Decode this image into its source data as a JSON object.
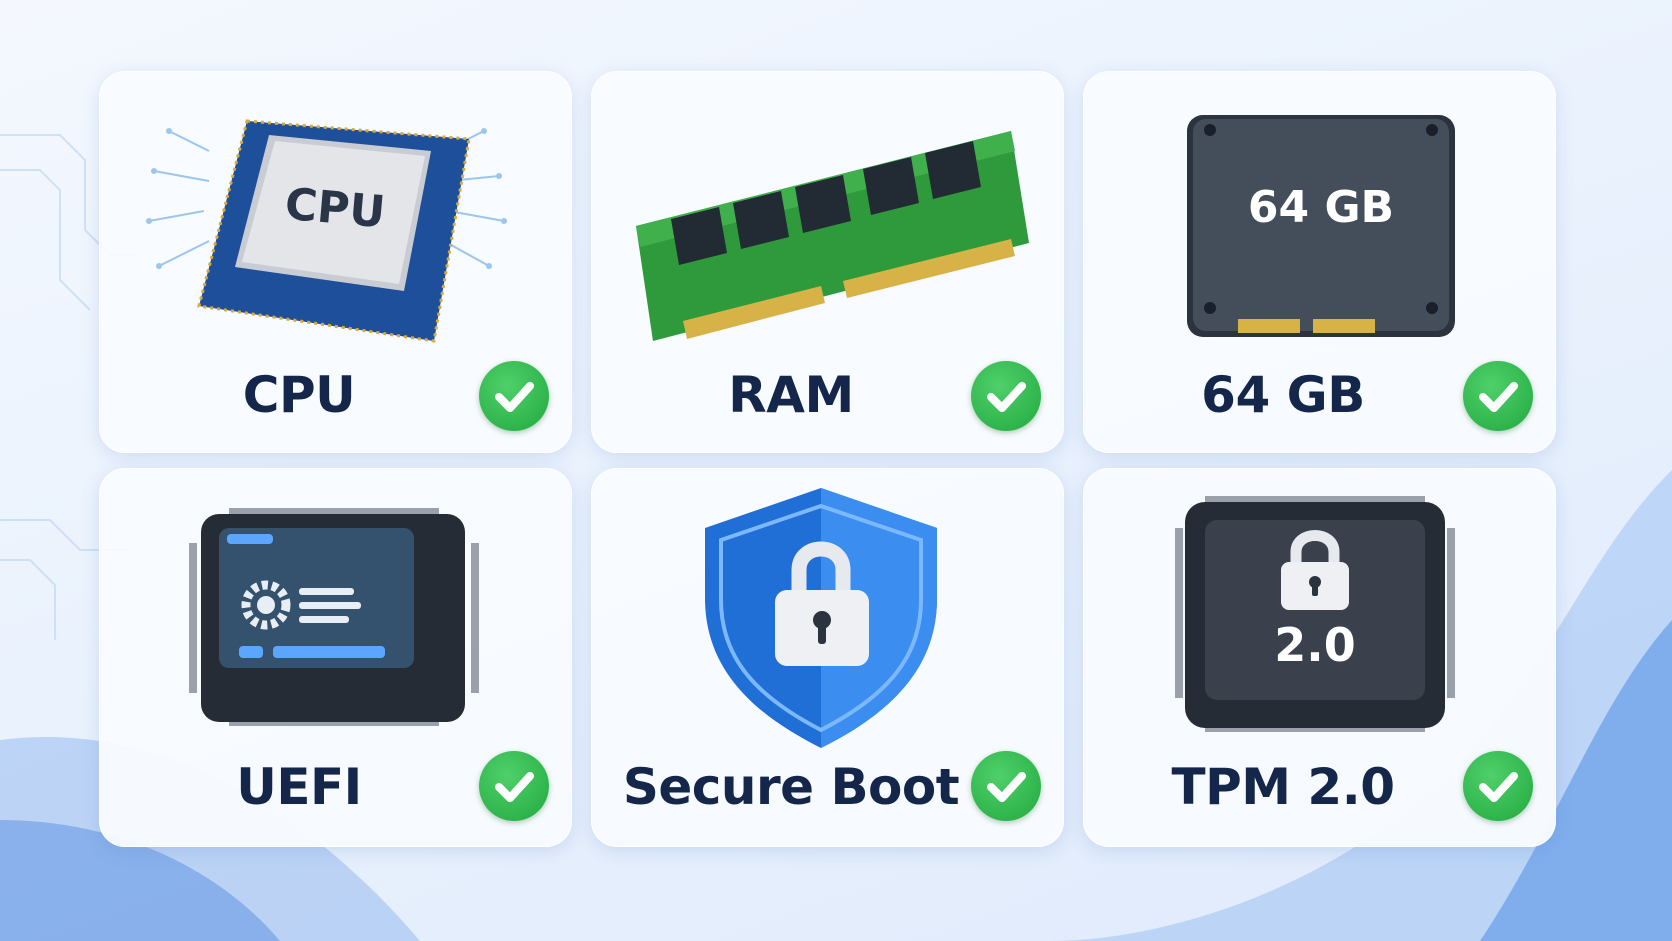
{
  "components": [
    {
      "id": "cpu",
      "label": "CPU",
      "chip_text": "CPU",
      "status": "pass",
      "icon": "cpu-chip-icon"
    },
    {
      "id": "ram",
      "label": "RAM",
      "status": "pass",
      "icon": "ram-module-icon"
    },
    {
      "id": "storage",
      "label": "64 GB",
      "drive_text": "64 GB",
      "status": "pass",
      "icon": "ssd-drive-icon"
    },
    {
      "id": "uefi",
      "label": "UEFI",
      "status": "pass",
      "icon": "firmware-chip-icon"
    },
    {
      "id": "secure_boot",
      "label": "Secure Boot",
      "status": "pass",
      "icon": "shield-lock-icon"
    },
    {
      "id": "tpm",
      "label": "TPM 2.0",
      "chip_text": "2.0",
      "status": "pass",
      "icon": "tpm-chip-icon"
    }
  ],
  "colors": {
    "label_text": "#14264a",
    "check_green": "#2bb84a",
    "card_bg": "#f8fbff",
    "accent_blue": "#2f7de6"
  }
}
